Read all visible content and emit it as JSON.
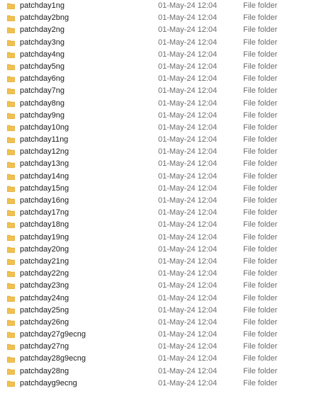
{
  "folder_icon": {
    "name": "folder-icon",
    "color": "#f1c150",
    "edge": "#e2a82c"
  },
  "rows": [
    {
      "name": "patchday1ng",
      "date": "01-May-24 12:04",
      "type": "File folder"
    },
    {
      "name": "patchday2bng",
      "date": "01-May-24 12:04",
      "type": "File folder"
    },
    {
      "name": "patchday2ng",
      "date": "01-May-24 12:04",
      "type": "File folder"
    },
    {
      "name": "patchday3ng",
      "date": "01-May-24 12:04",
      "type": "File folder"
    },
    {
      "name": "patchday4ng",
      "date": "01-May-24 12:04",
      "type": "File folder"
    },
    {
      "name": "patchday5ng",
      "date": "01-May-24 12:04",
      "type": "File folder"
    },
    {
      "name": "patchday6ng",
      "date": "01-May-24 12:04",
      "type": "File folder"
    },
    {
      "name": "patchday7ng",
      "date": "01-May-24 12:04",
      "type": "File folder"
    },
    {
      "name": "patchday8ng",
      "date": "01-May-24 12:04",
      "type": "File folder"
    },
    {
      "name": "patchday9ng",
      "date": "01-May-24 12:04",
      "type": "File folder"
    },
    {
      "name": "patchday10ng",
      "date": "01-May-24 12:04",
      "type": "File folder"
    },
    {
      "name": "patchday11ng",
      "date": "01-May-24 12:04",
      "type": "File folder"
    },
    {
      "name": "patchday12ng",
      "date": "01-May-24 12:04",
      "type": "File folder"
    },
    {
      "name": "patchday13ng",
      "date": "01-May-24 12:04",
      "type": "File folder"
    },
    {
      "name": "patchday14ng",
      "date": "01-May-24 12:04",
      "type": "File folder"
    },
    {
      "name": "patchday15ng",
      "date": "01-May-24 12:04",
      "type": "File folder"
    },
    {
      "name": "patchday16ng",
      "date": "01-May-24 12:04",
      "type": "File folder"
    },
    {
      "name": "patchday17ng",
      "date": "01-May-24 12:04",
      "type": "File folder"
    },
    {
      "name": "patchday18ng",
      "date": "01-May-24 12:04",
      "type": "File folder"
    },
    {
      "name": "patchday19ng",
      "date": "01-May-24 12:04",
      "type": "File folder"
    },
    {
      "name": "patchday20ng",
      "date": "01-May-24 12:04",
      "type": "File folder"
    },
    {
      "name": "patchday21ng",
      "date": "01-May-24 12:04",
      "type": "File folder"
    },
    {
      "name": "patchday22ng",
      "date": "01-May-24 12:04",
      "type": "File folder"
    },
    {
      "name": "patchday23ng",
      "date": "01-May-24 12:04",
      "type": "File folder"
    },
    {
      "name": "patchday24ng",
      "date": "01-May-24 12:04",
      "type": "File folder"
    },
    {
      "name": "patchday25ng",
      "date": "01-May-24 12:04",
      "type": "File folder"
    },
    {
      "name": "patchday26ng",
      "date": "01-May-24 12:04",
      "type": "File folder"
    },
    {
      "name": "patchday27g9ecng",
      "date": "01-May-24 12:04",
      "type": "File folder"
    },
    {
      "name": "patchday27ng",
      "date": "01-May-24 12:04",
      "type": "File folder"
    },
    {
      "name": "patchday28g9ecng",
      "date": "01-May-24 12:04",
      "type": "File folder"
    },
    {
      "name": "patchday28ng",
      "date": "01-May-24 12:04",
      "type": "File folder"
    },
    {
      "name": "patchdayg9ecng",
      "date": "01-May-24 12:04",
      "type": "File folder"
    }
  ]
}
